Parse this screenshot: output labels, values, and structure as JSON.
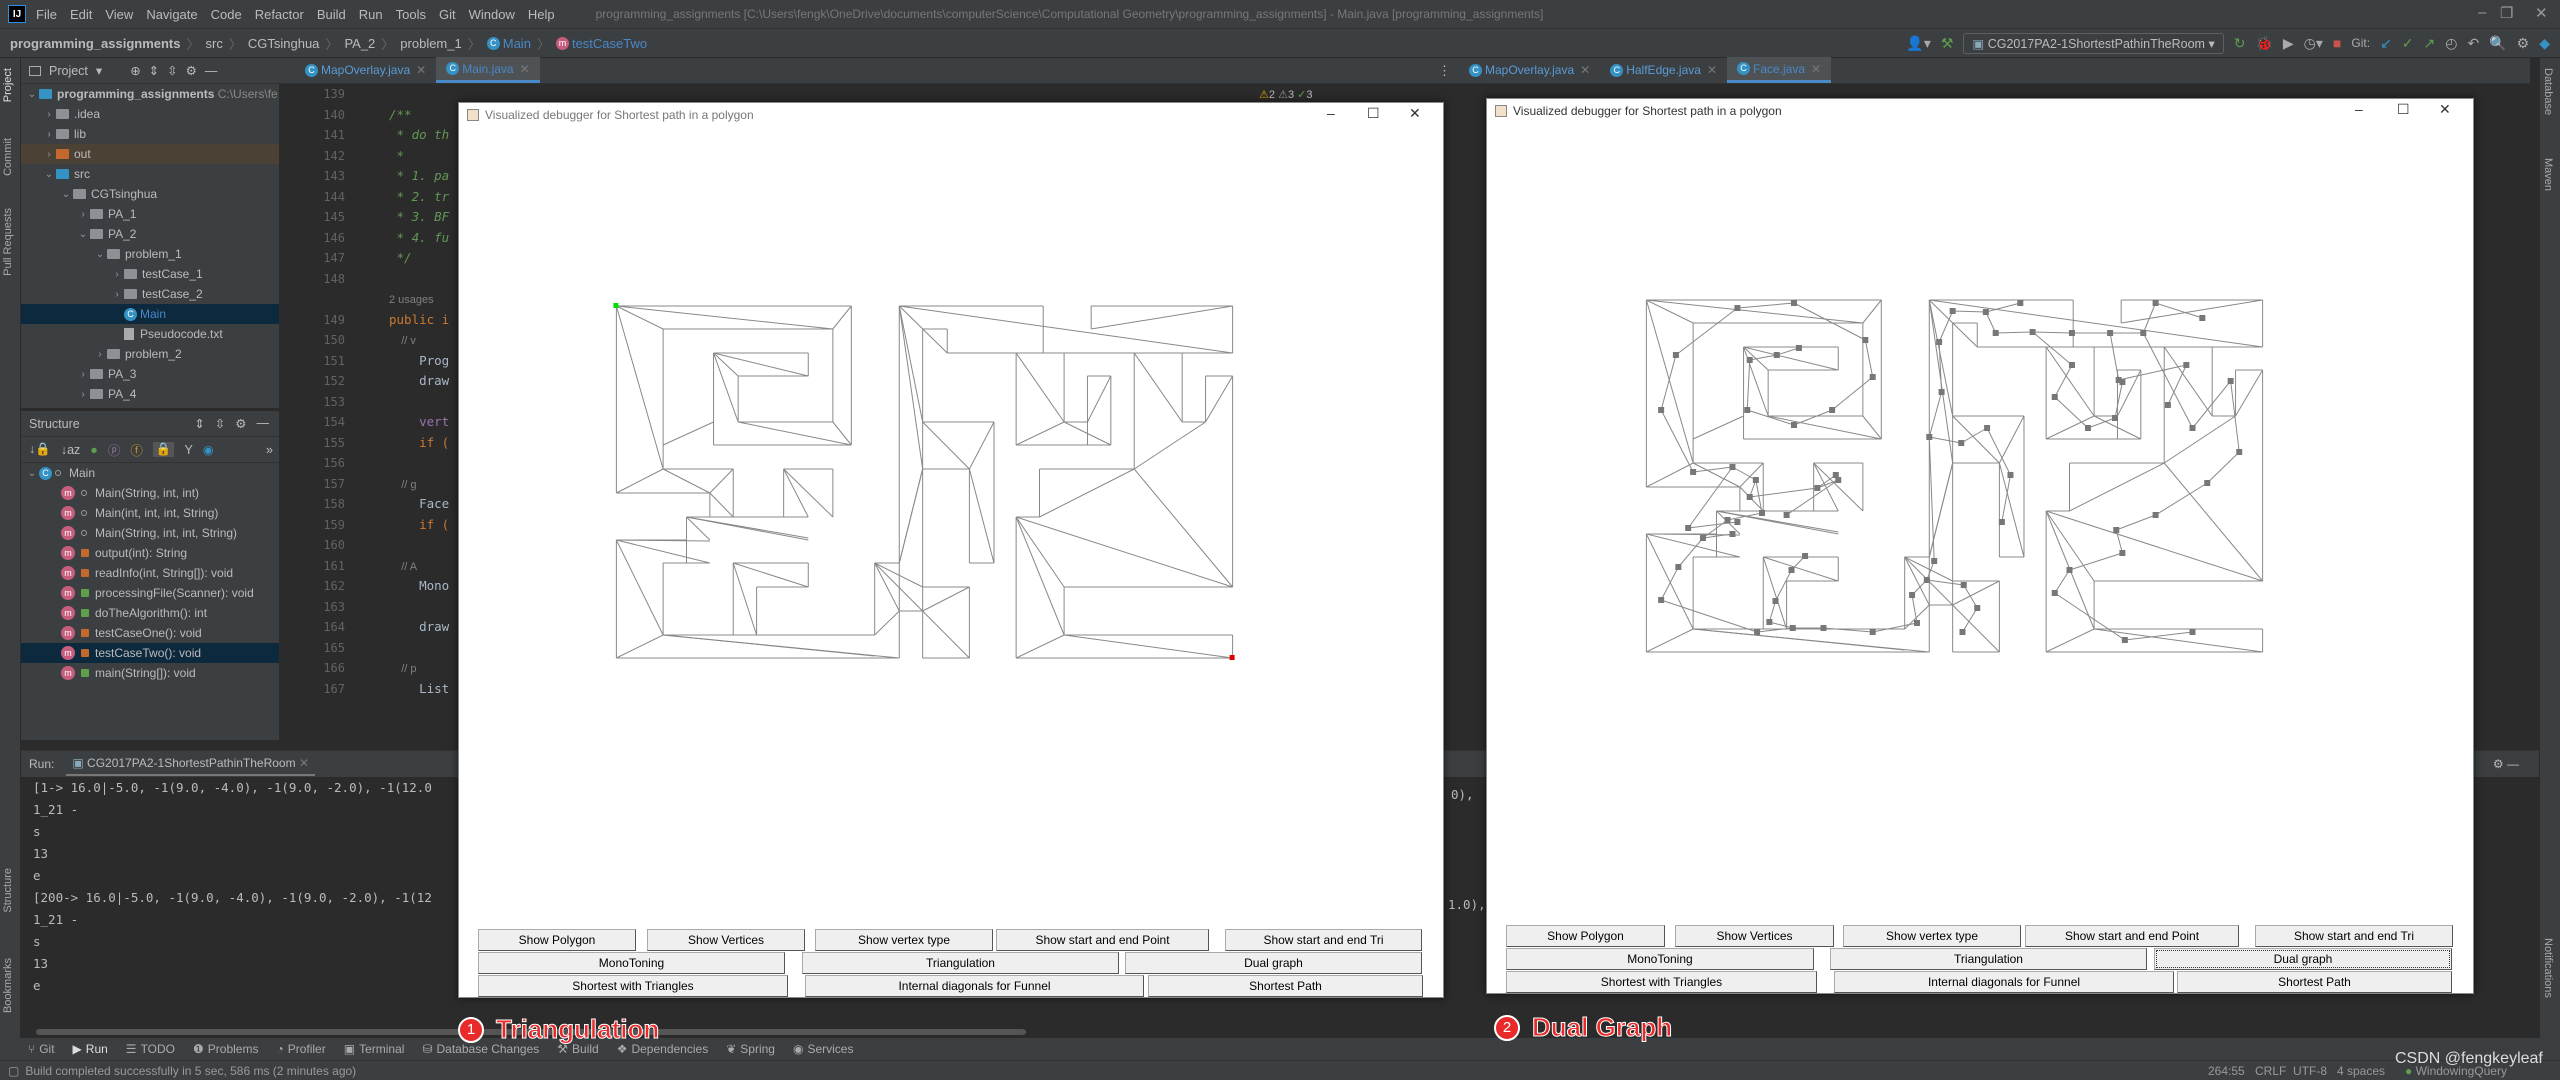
{
  "titlebar": {
    "menu": [
      "File",
      "Edit",
      "View",
      "Navigate",
      "Code",
      "Refactor",
      "Build",
      "Run",
      "Tools",
      "Git",
      "Window",
      "Help"
    ],
    "window_title": "programming_assignments [C:\\Users\\fengk\\OneDrive\\documents\\computerScience\\Computational Geometry\\programming_assignments] - Main.java [programming_assignments]"
  },
  "breadcrumb": [
    "programming_assignments",
    "src",
    "CGTsinghua",
    "PA_2",
    "problem_1",
    "Main",
    "testCaseTwo"
  ],
  "toolbar": {
    "run_config": "CG2017PA2-1ShortestPathinTheRoom",
    "git_label": "Git:"
  },
  "project_panel": {
    "title": "Project",
    "root": "programming_assignments",
    "root_path": "C:\\Users\\fe",
    "items": [
      {
        "label": ".idea",
        "depth": 1,
        "expanded": false,
        "type": "folder"
      },
      {
        "label": "lib",
        "depth": 1,
        "expanded": false,
        "type": "folder"
      },
      {
        "label": "out",
        "depth": 1,
        "expanded": false,
        "type": "folder-excluded"
      },
      {
        "label": "src",
        "depth": 1,
        "expanded": true,
        "type": "folder-source"
      },
      {
        "label": "CGTsinghua",
        "depth": 2,
        "expanded": true,
        "type": "package"
      },
      {
        "label": "PA_1",
        "depth": 3,
        "expanded": false,
        "type": "package"
      },
      {
        "label": "PA_2",
        "depth": 3,
        "expanded": true,
        "type": "package"
      },
      {
        "label": "problem_1",
        "depth": 4,
        "expanded": true,
        "type": "package"
      },
      {
        "label": "testCase_1",
        "depth": 5,
        "expanded": false,
        "type": "package"
      },
      {
        "label": "testCase_2",
        "depth": 5,
        "expanded": false,
        "type": "package"
      },
      {
        "label": "Main",
        "depth": 5,
        "type": "class",
        "selected": true
      },
      {
        "label": "Pseudocode.txt",
        "depth": 5,
        "type": "file"
      },
      {
        "label": "problem_2",
        "depth": 4,
        "expanded": false,
        "type": "package"
      },
      {
        "label": "PA_3",
        "depth": 3,
        "expanded": false,
        "type": "package"
      },
      {
        "label": "PA_4",
        "depth": 3,
        "expanded": false,
        "type": "package"
      }
    ]
  },
  "structure_panel": {
    "title": "Structure",
    "root": "Main",
    "members": [
      {
        "label": "Main(String, int, int)",
        "access": "package"
      },
      {
        "label": "Main(int, int, int, String)",
        "access": "package"
      },
      {
        "label": "Main(String, int, int, String)",
        "access": "package"
      },
      {
        "label": "output(int): String",
        "access": "private"
      },
      {
        "label": "readInfo(int, String[]): void",
        "access": "private"
      },
      {
        "label": "processingFile(Scanner): void",
        "access": "public"
      },
      {
        "label": "doTheAlgorithm(): int",
        "access": "public"
      },
      {
        "label": "testCaseOne(): void",
        "access": "private"
      },
      {
        "label": "testCaseTwo(): void",
        "access": "private",
        "selected": true
      },
      {
        "label": "main(String[]): void",
        "access": "public"
      }
    ]
  },
  "editor_left": {
    "tabs": [
      {
        "label": "MapOverlay.java",
        "active": false
      },
      {
        "label": "Main.java",
        "active": true
      }
    ],
    "inspections": {
      "warnings": "2",
      "weak_warnings": "3",
      "ok": "3"
    },
    "line_numbers": [
      "139",
      "140",
      "141",
      "142",
      "143",
      "144",
      "145",
      "146",
      "147",
      "148",
      "",
      "149",
      "150",
      "151",
      "152",
      "153",
      "154",
      "155",
      "156",
      "157",
      "158",
      "159",
      "160",
      "161",
      "162",
      "163",
      "164",
      "165",
      "166",
      "167"
    ],
    "code_lines": [
      {
        "t": "",
        "c": "pl"
      },
      {
        "t": "/**",
        "c": "cm"
      },
      {
        "t": " * do th",
        "c": "cm"
      },
      {
        "t": " *",
        "c": "cm"
      },
      {
        "t": " * 1. pa",
        "c": "cm"
      },
      {
        "t": " * 2. tr",
        "c": "cm"
      },
      {
        "t": " * 3. BF",
        "c": "cm"
      },
      {
        "t": " * 4. fu",
        "c": "cm"
      },
      {
        "t": " */",
        "c": "cm"
      },
      {
        "t": "",
        "c": "pl"
      },
      {
        "t": "2 usages",
        "c": "gr"
      },
      {
        "t": "public i",
        "c": "kw"
      },
      {
        "t": "    // v",
        "c": "gr"
      },
      {
        "t": "    Prog",
        "c": "pl"
      },
      {
        "t": "    draw",
        "c": "pl"
      },
      {
        "t": "",
        "c": "pl"
      },
      {
        "t": "    vert",
        "c": "pv"
      },
      {
        "t": "    if (",
        "c": "kw"
      },
      {
        "t": "",
        "c": "pl"
      },
      {
        "t": "    // g",
        "c": "gr"
      },
      {
        "t": "    Face",
        "c": "pl"
      },
      {
        "t": "    if (",
        "c": "kw"
      },
      {
        "t": "",
        "c": "pl"
      },
      {
        "t": "    // A",
        "c": "gr"
      },
      {
        "t": "    Mono",
        "c": "pl"
      },
      {
        "t": "",
        "c": "pl"
      },
      {
        "t": "    draw",
        "c": "pl"
      },
      {
        "t": "",
        "c": "pl"
      },
      {
        "t": "    // p",
        "c": "gr"
      },
      {
        "t": "    List",
        "c": "pl"
      }
    ]
  },
  "editor_right": {
    "tabs": [
      {
        "label": "MapOverlay.java",
        "active": false
      },
      {
        "label": "HalfEdge.java",
        "active": false
      },
      {
        "label": "Face.java",
        "active": true
      }
    ]
  },
  "run_panel": {
    "label": "Run:",
    "tab": "CG2017PA2-1ShortestPathinTheRoom",
    "lines": [
      "[1-> 16.0|-5.0, -1(9.0, -4.0), -1(9.0, -2.0), -1(12.0",
      "1_21 -",
      "s",
      "13",
      "e",
      "[200-> 16.0|-5.0, -1(9.0, -4.0), -1(9.0, -2.0), -1(12",
      "1_21 -",
      "s",
      "13",
      "e"
    ],
    "right_fragments": [
      "0),",
      "1.0),"
    ]
  },
  "debugger_windows": [
    {
      "title": "Visualized debugger for Shortest path in a polygon",
      "mode": "Triangulation",
      "buttons_row1": [
        "Show Polygon",
        "Show Vertices",
        "Show vertex type",
        "Show start and end Point",
        "Show start and end Tri"
      ],
      "buttons_row2": [
        "MonoToning",
        "Triangulation",
        "Dual graph"
      ],
      "buttons_row3": [
        "Shortest with Triangles",
        "Internal diagonals for Funnel",
        "Shortest Path"
      ],
      "start_color": "#00e000",
      "end_color": "#e00000"
    },
    {
      "title": "Visualized debugger for Shortest path in a polygon",
      "mode": "Dual Graph",
      "focused_button": "Dual graph",
      "buttons_row1": [
        "Show Polygon",
        "Show Vertices",
        "Show vertex type",
        "Show start and end Point",
        "Show start and end Tri"
      ],
      "buttons_row2": [
        "MonoToning",
        "Triangulation",
        "Dual graph"
      ],
      "buttons_row3": [
        "Shortest with Triangles",
        "Internal diagonals for Funnel",
        "Shortest Path"
      ]
    }
  ],
  "annotations": [
    {
      "number": "1",
      "label": "Triangulation"
    },
    {
      "number": "2",
      "label": "Dual Graph"
    }
  ],
  "bottom_tools": [
    "Git",
    "Run",
    "TODO",
    "Problems",
    "Profiler",
    "Terminal",
    "Database Changes",
    "Build",
    "Dependencies",
    "Spring",
    "Services"
  ],
  "left_strip_labels": [
    "Project",
    "Commit",
    "Pull Requests",
    "Structure",
    "Bookmarks"
  ],
  "right_strip_labels": [
    "Database",
    "Maven",
    "Notifications"
  ],
  "status": {
    "message": "Build completed successfully in 5 sec, 586 ms (2 minutes ago)",
    "position": "264:55",
    "line_sep": "CRLF",
    "encoding": "UTF-8",
    "indent": "4 spaces",
    "branch": "WindowingQuery",
    "watermark": "CSDN @fengkeyleaf"
  },
  "colors": {
    "accent": "#4a88c7",
    "annotation": "#e82a2a",
    "selection": "#0d293e"
  }
}
